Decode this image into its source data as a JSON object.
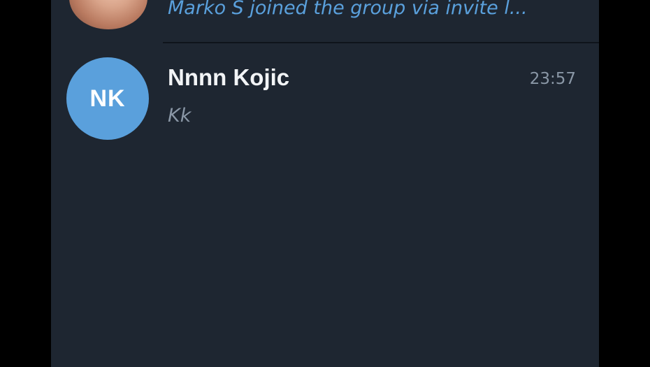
{
  "chats": [
    {
      "preview": "Marko S joined the group via invite l...",
      "avatar_icon": "user-photo-avatar"
    },
    {
      "initials": "NK",
      "name": "Nnnn Kojic",
      "time": "23:57",
      "preview": "Kk",
      "avatar_color": "#5aa0dc"
    }
  ],
  "colors": {
    "background": "#1e2631",
    "accent": "#5aa0dc",
    "muted_text": "#8a97a6",
    "primary_text": "#f2f4f6"
  }
}
